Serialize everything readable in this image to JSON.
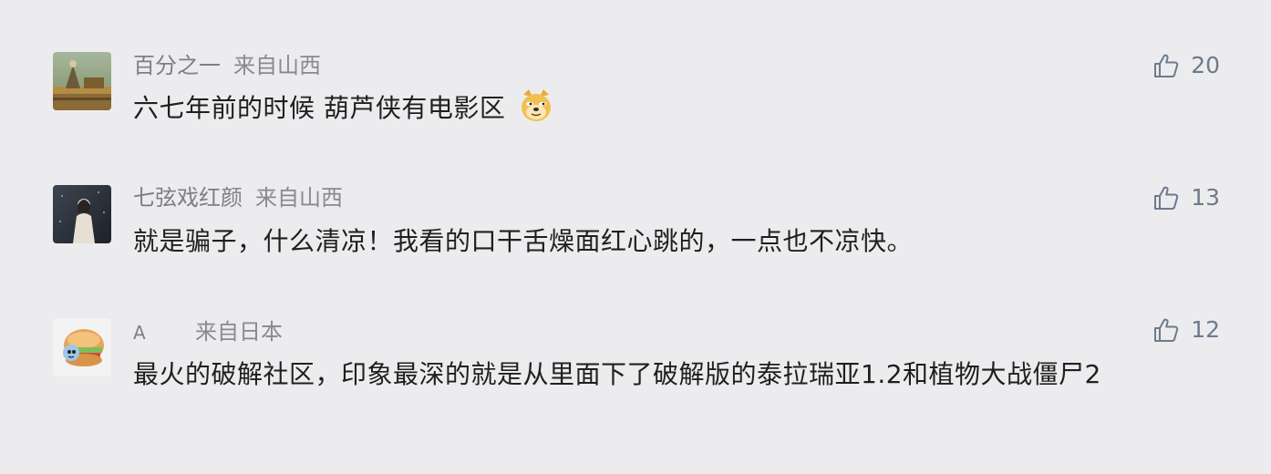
{
  "comments": [
    {
      "username": "百分之一",
      "location": "来自山西",
      "text": "六七年前的时候 葫芦侠有电影区",
      "emoji": "doge-emoji",
      "likes": "20",
      "avatar": "avatar-landscape-figure"
    },
    {
      "username": "七弦戏红颜",
      "location": "来自山西",
      "text": "就是骗子，什么清凉！我看的口干舌燥面红心跳的，一点也不凉快。",
      "likes": "13",
      "avatar": "avatar-dark-figure"
    },
    {
      "username": "A",
      "location": "来自日本",
      "text": "最火的破解社区，印象最深的就是从里面下了破解版的泰拉瑞亚1.2和植物大战僵尸2",
      "likes": "12",
      "avatar": "avatar-cartoon"
    }
  ],
  "icons": {
    "like": "thumbs-up-icon"
  },
  "colors": {
    "background": "#ececee",
    "meta_text": "#8a8a8e",
    "body_text": "#1f1f1f",
    "like": "#6d7a8c"
  }
}
